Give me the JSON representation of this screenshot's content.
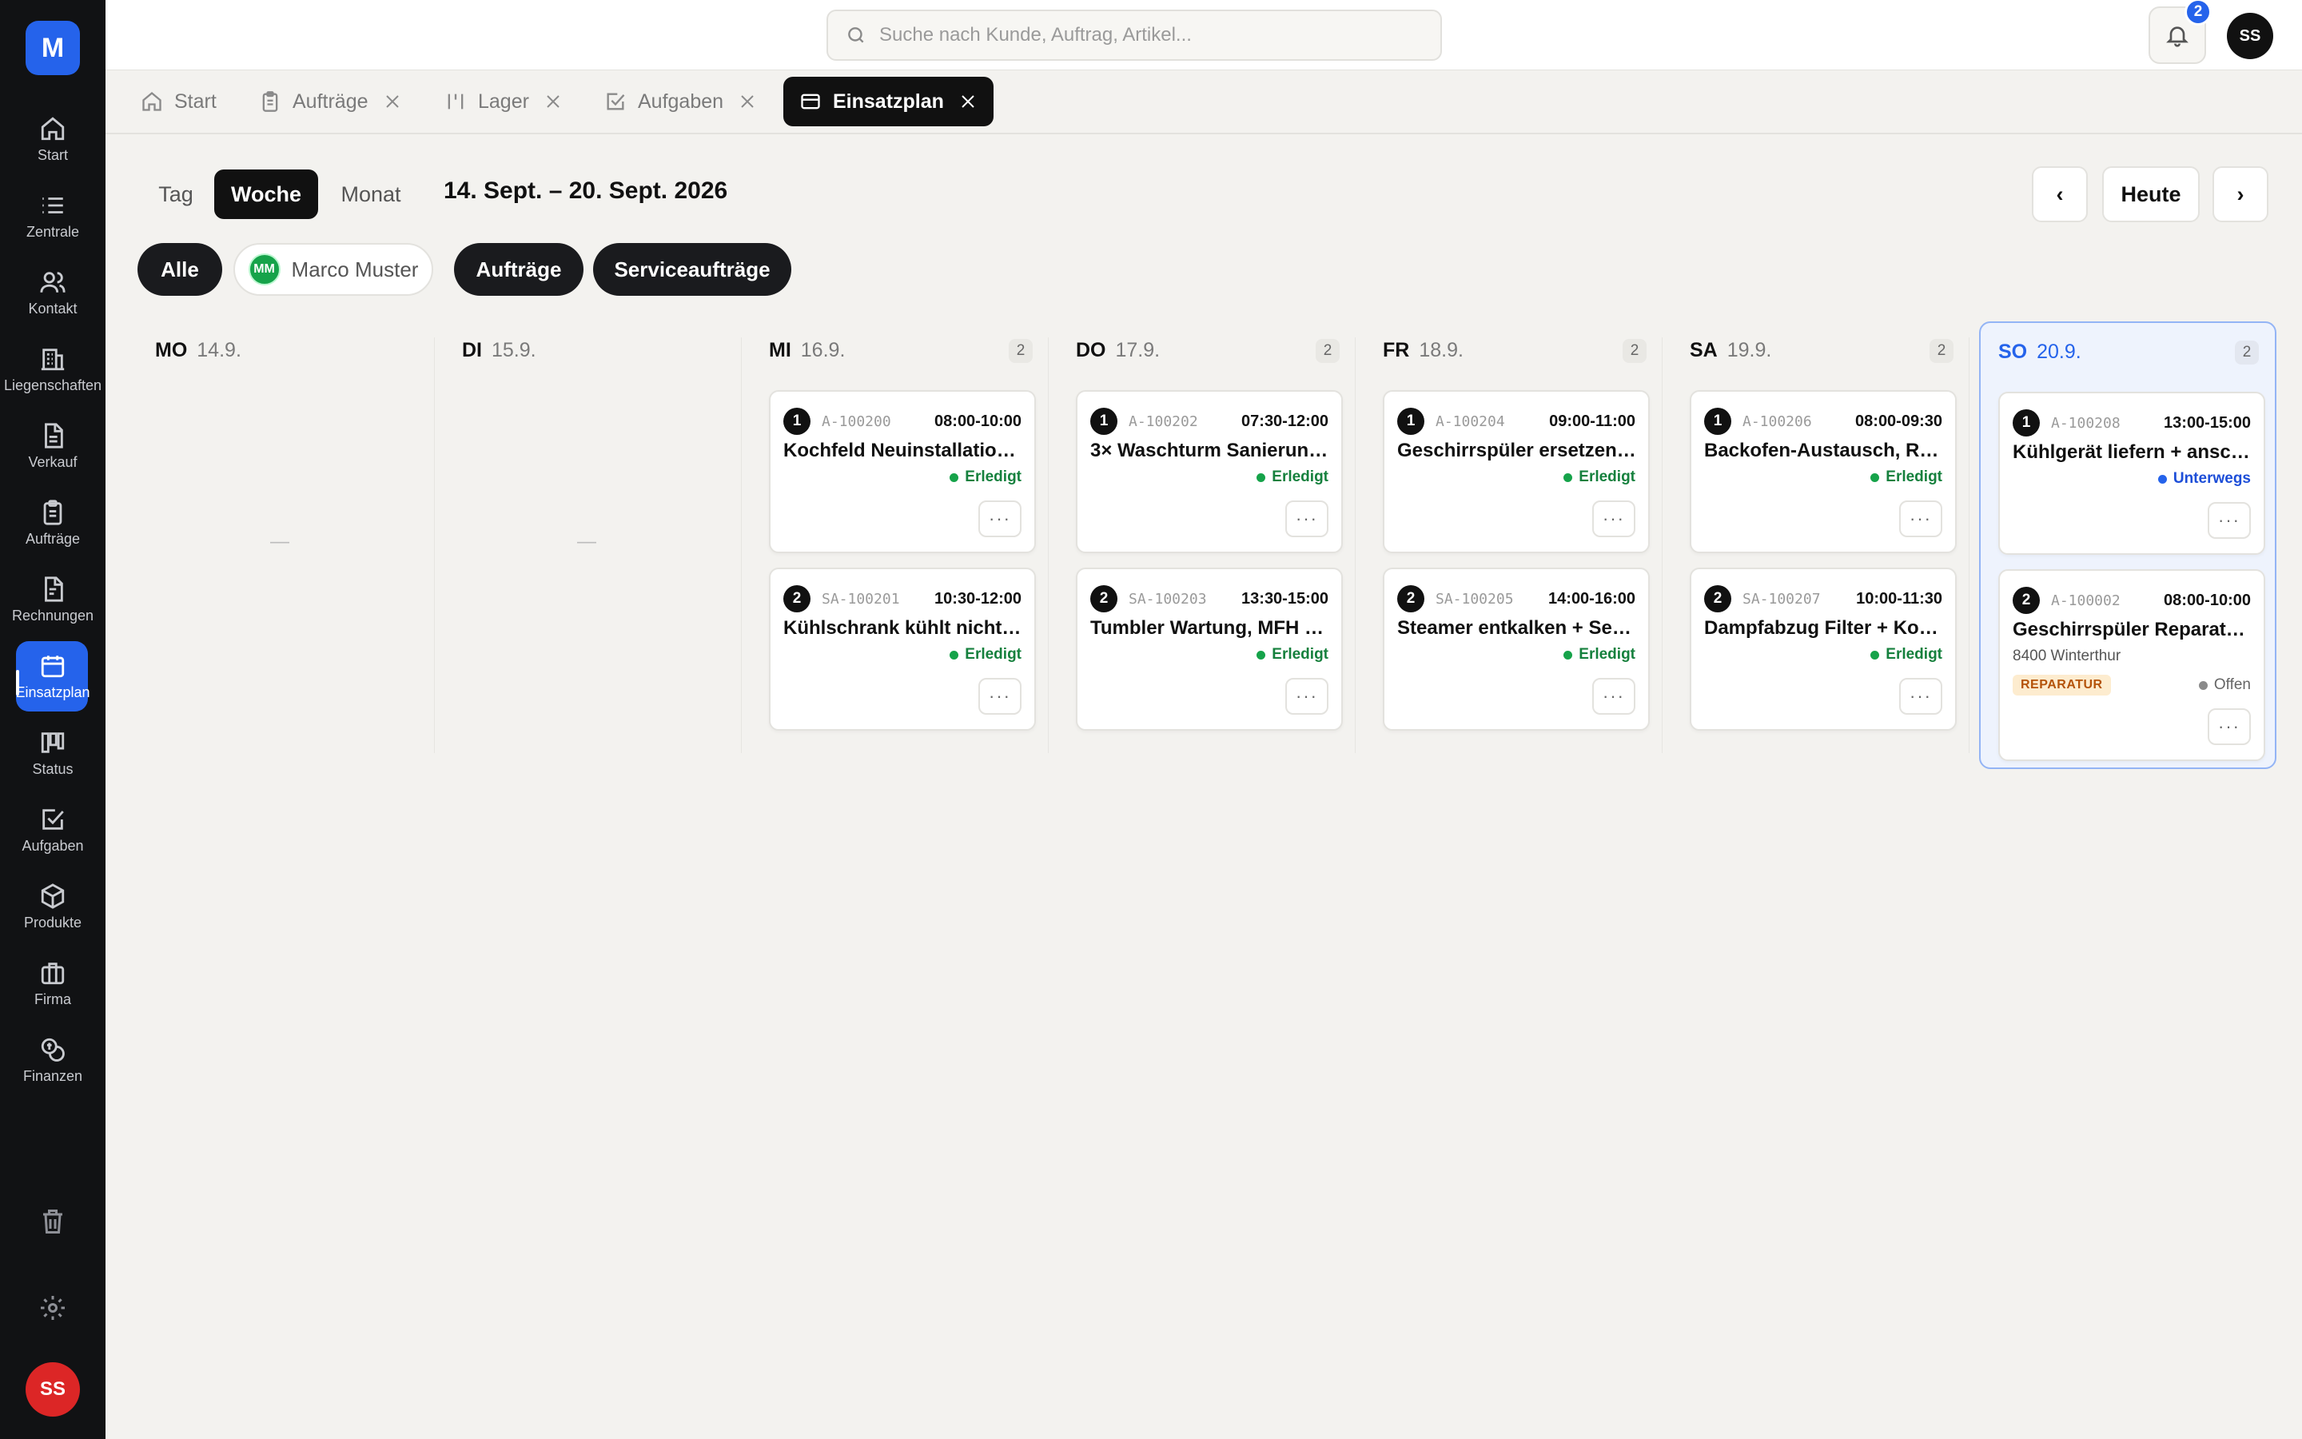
{
  "app": {
    "logo": "M"
  },
  "sidebar": {
    "items": [
      {
        "label": "Start",
        "icon": "home-icon"
      },
      {
        "label": "Zentrale",
        "icon": "list-icon"
      },
      {
        "label": "Kontakt",
        "icon": "users-icon"
      },
      {
        "label": "Liegenschaften",
        "icon": "building-icon"
      },
      {
        "label": "Verkauf",
        "icon": "document-icon"
      },
      {
        "label": "Aufträge",
        "icon": "clipboard-icon"
      },
      {
        "label": "Rechnungen",
        "icon": "invoice-icon"
      },
      {
        "label": "Einsatzplan",
        "icon": "calendar-icon",
        "active": true
      },
      {
        "label": "Status",
        "icon": "kanban-icon"
      },
      {
        "label": "Aufgaben",
        "icon": "checkbox-icon"
      },
      {
        "label": "Produkte",
        "icon": "box-icon"
      },
      {
        "label": "Firma",
        "icon": "briefcase-icon"
      },
      {
        "label": "Finanzen",
        "icon": "coins-icon"
      }
    ],
    "user_initials": "SS"
  },
  "topbar": {
    "search_placeholder": "Suche nach Kunde, Auftrag, Artikel...",
    "notification_count": "2",
    "user_initials": "SS"
  },
  "tabs": [
    {
      "label": "Start",
      "closable": false
    },
    {
      "label": "Aufträge",
      "closable": true
    },
    {
      "label": "Lager",
      "closable": true
    },
    {
      "label": "Aufgaben",
      "closable": true
    },
    {
      "label": "Einsatzplan",
      "closable": true,
      "active": true
    }
  ],
  "toolbar": {
    "views": [
      "Tag",
      "Woche",
      "Monat"
    ],
    "active_view": "Woche",
    "range": "14. Sept. – 20. Sept. 2026",
    "prev": "‹",
    "today": "Heute",
    "next": "›"
  },
  "filters": {
    "all": "Alle",
    "person_initials": "MM",
    "person_name": "Marco Muster",
    "orders": "Aufträge",
    "service_orders": "Serviceaufträge"
  },
  "colors": {
    "accent": "#2563eb",
    "done": "#16a34a",
    "onway": "#2563eb",
    "repair_tag": "#b45309"
  },
  "days": [
    {
      "name": "MO",
      "date": "14.9.",
      "count": "",
      "empty": "—",
      "cards": []
    },
    {
      "name": "DI",
      "date": "15.9.",
      "count": "",
      "empty": "—",
      "cards": []
    },
    {
      "name": "MI",
      "date": "16.9.",
      "count": "2",
      "cards": [
        {
          "num": "1",
          "ref": "A-100200",
          "time": "08:00-10:00",
          "title": "Kochfeld Neuinstallation, K...",
          "status": "Erledigt",
          "state": "done"
        },
        {
          "num": "2",
          "ref": "SA-100201",
          "time": "10:30-12:00",
          "title": "Kühlschrank kühlt nicht —...",
          "status": "Erledigt",
          "state": "done"
        }
      ]
    },
    {
      "name": "DO",
      "date": "17.9.",
      "count": "2",
      "cards": [
        {
          "num": "1",
          "ref": "A-100202",
          "time": "07:30-12:00",
          "title": "3× Waschturm Sanierung ...",
          "status": "Erledigt",
          "state": "done"
        },
        {
          "num": "2",
          "ref": "SA-100203",
          "time": "13:30-15:00",
          "title": "Tumbler Wartung, MFH Lin...",
          "status": "Erledigt",
          "state": "done"
        }
      ]
    },
    {
      "name": "FR",
      "date": "18.9.",
      "count": "2",
      "cards": [
        {
          "num": "1",
          "ref": "A-100204",
          "time": "09:00-11:00",
          "title": "Geschirrspüler ersetzen, ...",
          "status": "Erledigt",
          "state": "done"
        },
        {
          "num": "2",
          "ref": "SA-100205",
          "time": "14:00-16:00",
          "title": "Steamer entkalken + Service",
          "status": "Erledigt",
          "state": "done"
        }
      ]
    },
    {
      "name": "SA",
      "date": "19.9.",
      "count": "2",
      "cards": [
        {
          "num": "1",
          "ref": "A-100206",
          "time": "08:00-09:30",
          "title": "Backofen-Austausch, Resta...",
          "status": "Erledigt",
          "state": "done"
        },
        {
          "num": "2",
          "ref": "SA-100207",
          "time": "10:00-11:30",
          "title": "Dampfabzug Filter + Kontr...",
          "status": "Erledigt",
          "state": "done"
        }
      ]
    },
    {
      "name": "SO",
      "date": "20.9.",
      "count": "2",
      "today": true,
      "cards": [
        {
          "num": "1",
          "ref": "A-100208",
          "time": "13:00-15:00",
          "title": "Kühlgerät liefern + anschli...",
          "status": "Unterwegs",
          "state": "onway"
        },
        {
          "num": "2",
          "ref": "A-100002",
          "time": "08:00-10:00",
          "title": "Geschirrspüler Reparatur, ...",
          "address": "8400 Winterthur",
          "tag": "REPARATUR",
          "status": "Offen",
          "state": "open"
        }
      ]
    }
  ],
  "more_label": "···"
}
